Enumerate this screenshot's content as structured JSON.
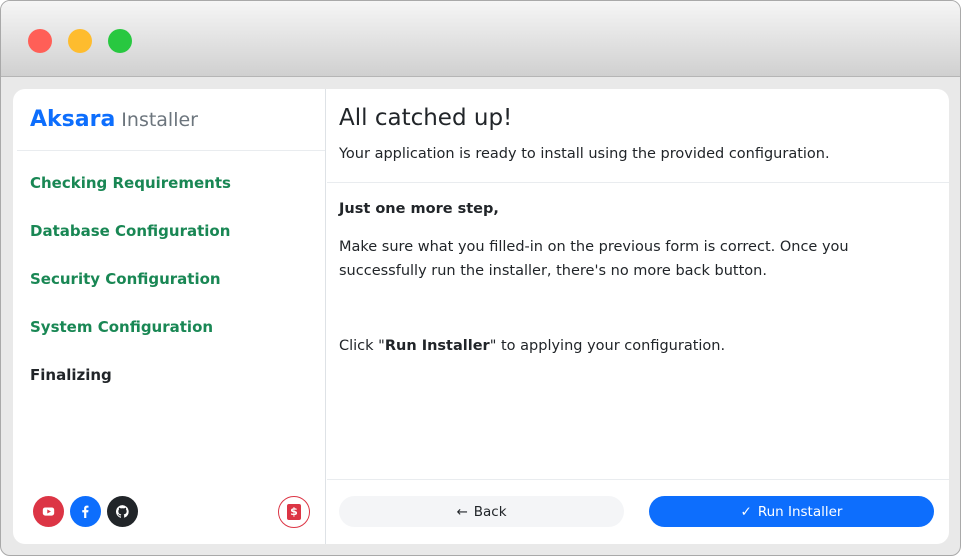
{
  "brand": {
    "name": "Aksara",
    "sub": "Installer"
  },
  "nav": [
    {
      "label": "Checking Requirements",
      "state": "done"
    },
    {
      "label": "Database Configuration",
      "state": "done"
    },
    {
      "label": "Security Configuration",
      "state": "done"
    },
    {
      "label": "System Configuration",
      "state": "done"
    },
    {
      "label": "Finalizing",
      "state": "active"
    }
  ],
  "main": {
    "title": "All catched up!",
    "subtitle": "Your application is ready to install using the provided configuration.",
    "step_title": "Just one more step,",
    "paragraph": "Make sure what you filled-in on the previous form is correct. Once you successfully run the installer, there's no more back button.",
    "instruction_prefix": "Click \"",
    "instruction_bold": "Run Installer",
    "instruction_suffix": "\" to applying your configuration."
  },
  "buttons": {
    "back": "Back",
    "run": "Run Installer"
  },
  "icons": {
    "back": "arrow-left-icon",
    "run": "check-icon",
    "youtube": "youtube-icon",
    "facebook": "facebook-icon",
    "github": "github-icon",
    "donate": "dollar-icon"
  },
  "colors": {
    "accent": "#0d6efd",
    "done": "#198754",
    "danger": "#dc3545"
  }
}
